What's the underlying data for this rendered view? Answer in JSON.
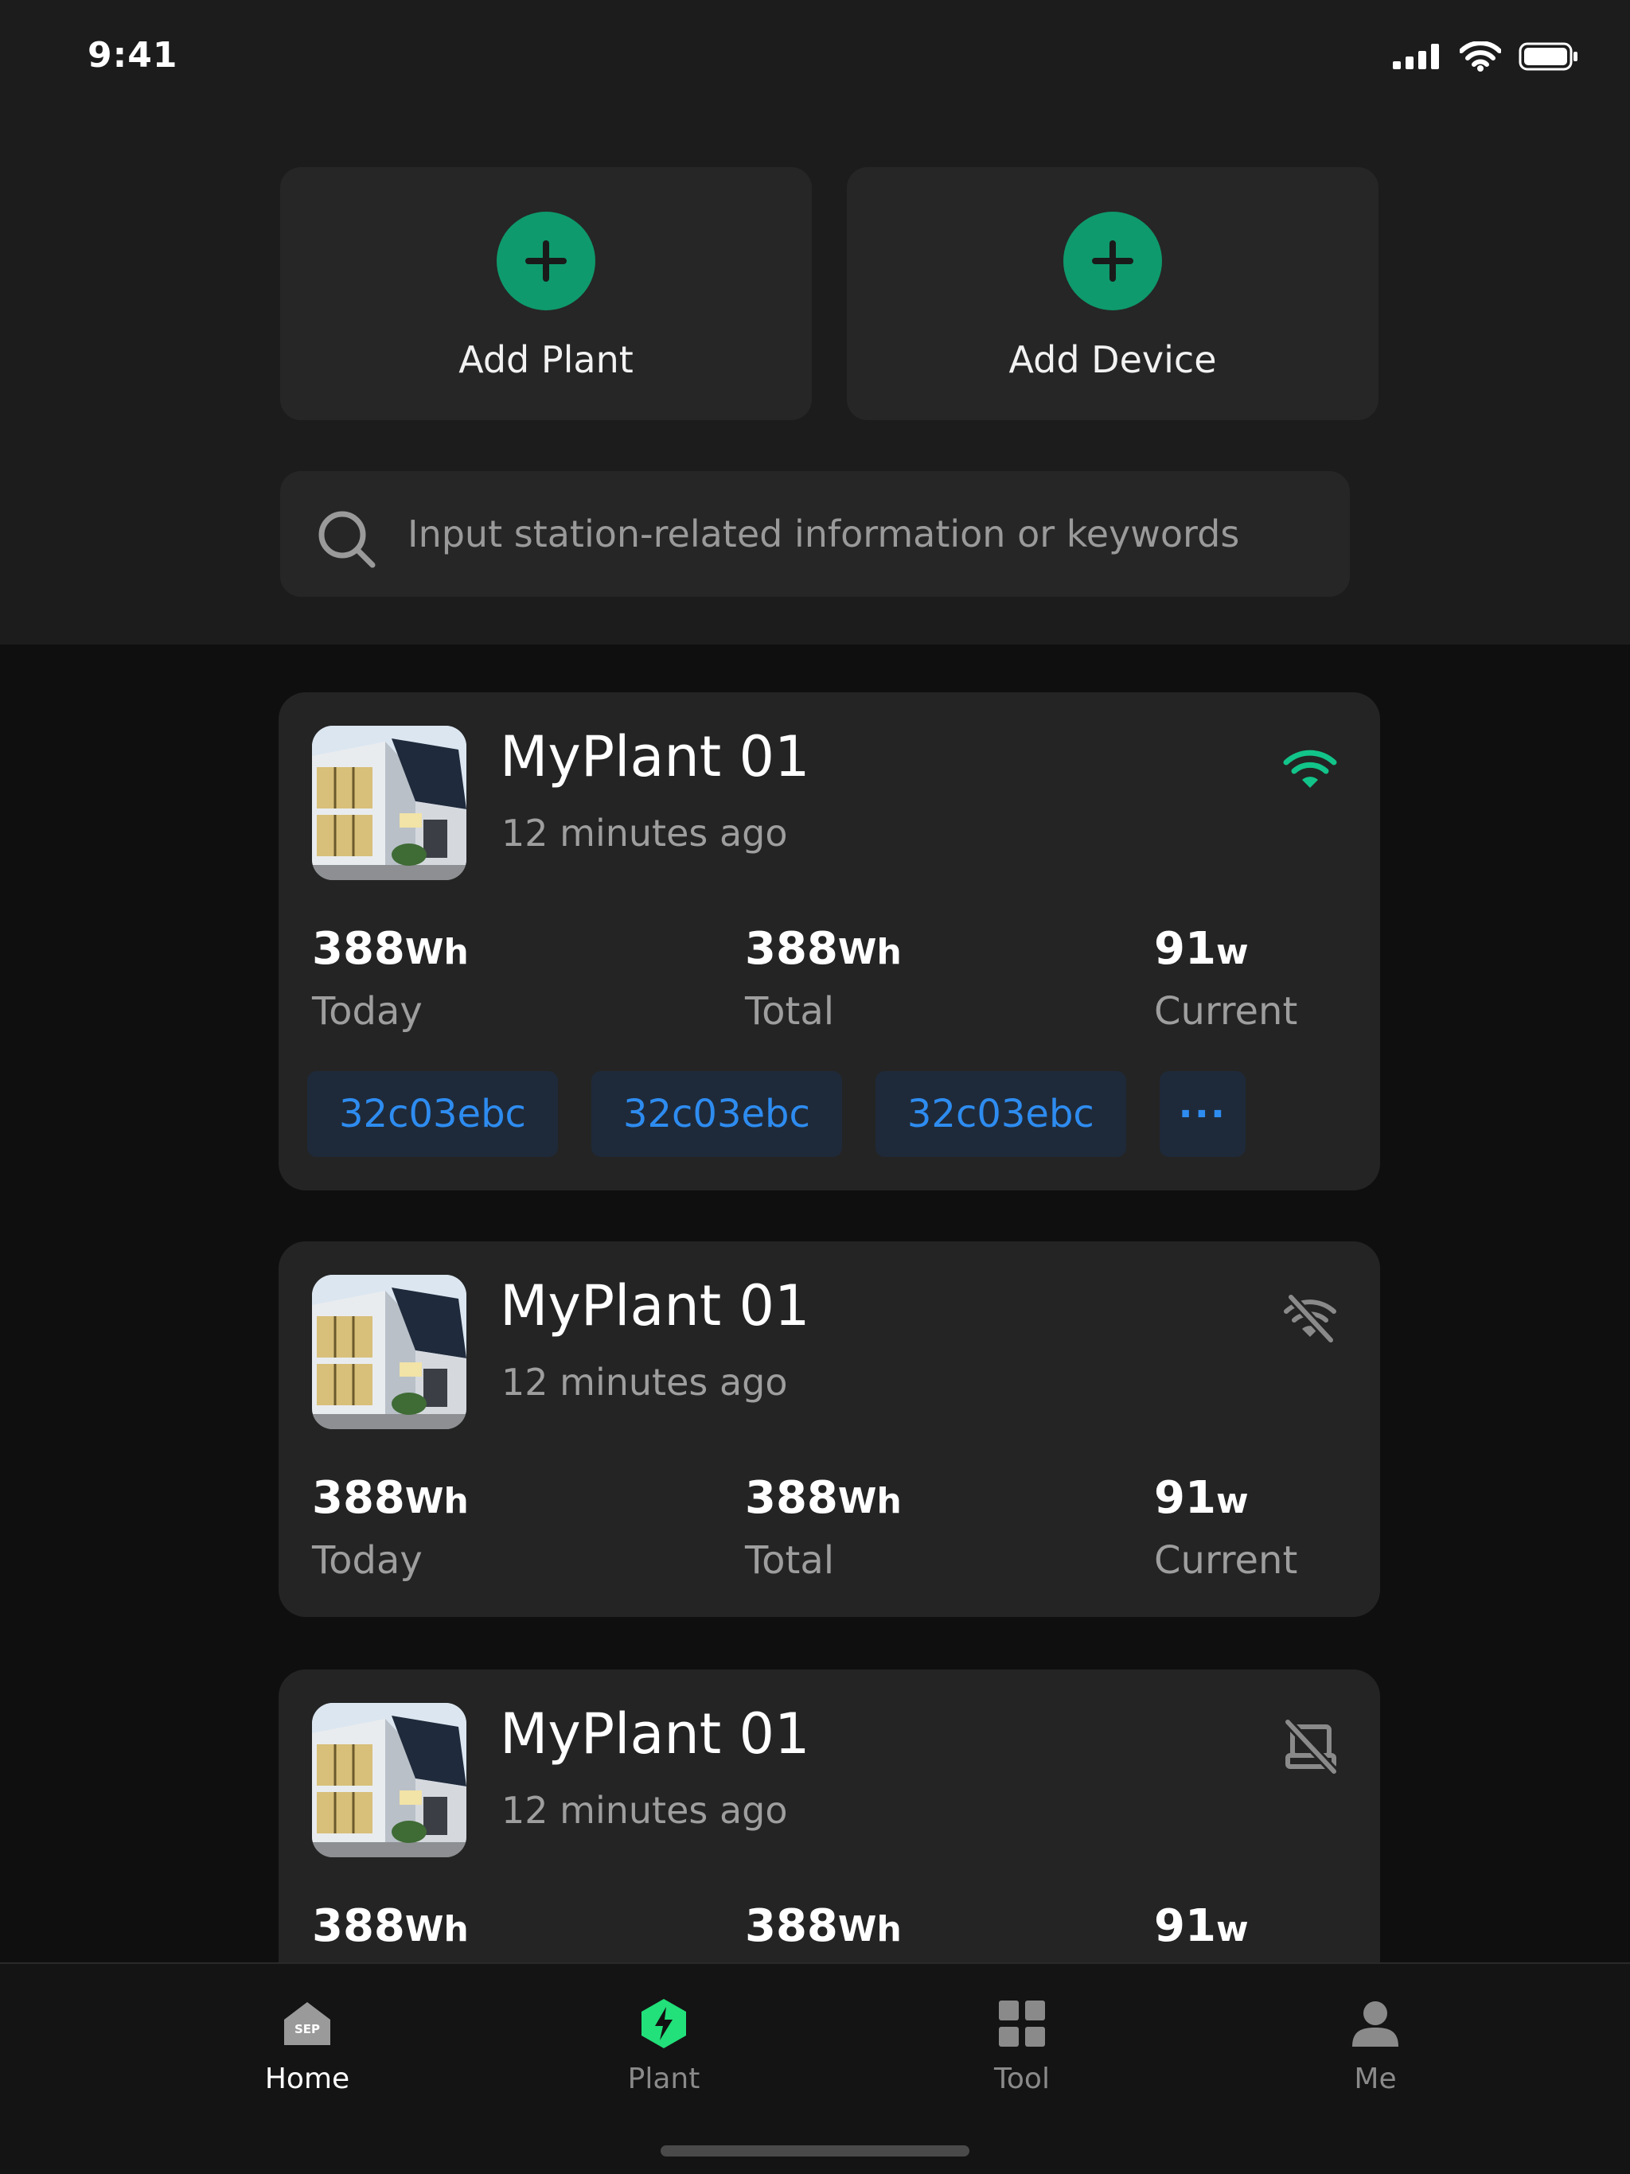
{
  "status_bar": {
    "time": "9:41"
  },
  "actions": {
    "add_plant_label": "Add Plant",
    "add_device_label": "Add Device"
  },
  "search": {
    "placeholder": "Input station-related information or keywords"
  },
  "plants": [
    {
      "name": "MyPlant 01",
      "updated": "12 minutes ago",
      "status_icon": "wifi-online-icon",
      "status_color": "#12c489",
      "today_value": "388",
      "today_unit": "Wh",
      "today_label": "Today",
      "total_value": "388",
      "total_unit": "Wh",
      "total_label": "Total",
      "current_value": "91",
      "current_unit": "w",
      "current_label": "Current",
      "devices": [
        "32c03ebc",
        "32c03ebc",
        "32c03ebc"
      ],
      "more_label": "···"
    },
    {
      "name": "MyPlant 01",
      "updated": "12 minutes ago",
      "status_icon": "wifi-off-icon",
      "status_color": "#8a8a8a",
      "today_value": "388",
      "today_unit": "Wh",
      "today_label": "Today",
      "total_value": "388",
      "total_unit": "Wh",
      "total_label": "Total",
      "current_value": "91",
      "current_unit": "w",
      "current_label": "Current"
    },
    {
      "name": "MyPlant 01",
      "updated": "12 minutes ago",
      "status_icon": "no-device-icon",
      "status_color": "#8a8a8a",
      "today_value": "388",
      "today_unit": "Wh",
      "total_value": "388",
      "total_unit": "Wh",
      "current_value": "91",
      "current_unit": "w"
    }
  ],
  "tabs": [
    {
      "label": "Home",
      "icon": "home-icon",
      "active": true
    },
    {
      "label": "Plant",
      "icon": "plant-bolt-icon",
      "active": false
    },
    {
      "label": "Tool",
      "icon": "grid-icon",
      "active": false
    },
    {
      "label": "Me",
      "icon": "person-icon",
      "active": false
    }
  ],
  "colors": {
    "accent": "#0e9a6c",
    "link": "#2e8cf0",
    "online": "#12c489"
  },
  "home_badge_text": "SEP"
}
